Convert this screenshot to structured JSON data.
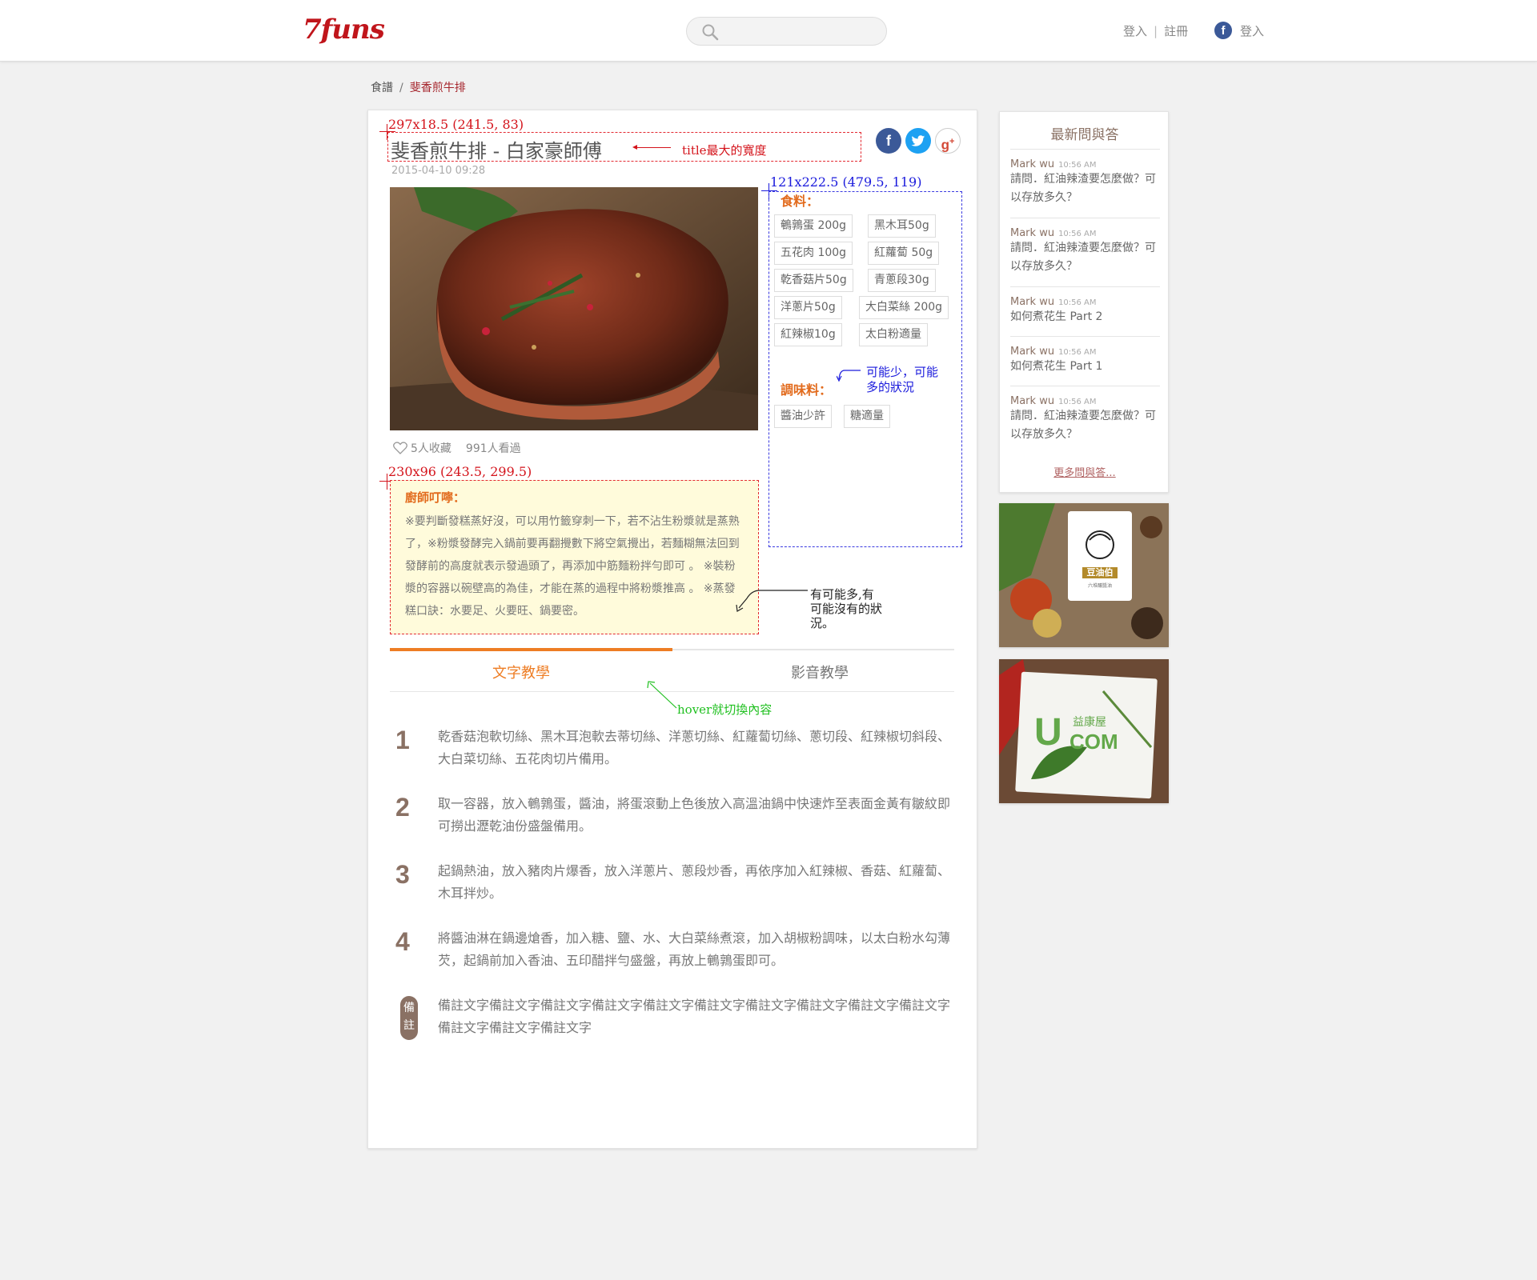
{
  "header": {
    "logo": "7funs",
    "login": "登入",
    "register": "註冊",
    "fb_login": "登入",
    "fb_icon": "f"
  },
  "breadcrumb": {
    "root": "食譜",
    "current": "斐香煎牛排"
  },
  "recipe": {
    "title": "斐香煎牛排 - 白家豪師傅",
    "date": "2015-04-10  09:28",
    "favorites": "5人收藏",
    "views": "991人看過",
    "ingredients_label": "食料：",
    "ingredients": [
      "鵪鶉蛋 200g",
      "黑木耳50g",
      "五花肉 100g",
      "紅蘿蔔 50g",
      "乾香菇片50g",
      "青蔥段30g",
      "洋蔥片50g",
      "大白菜絲 200g",
      "紅辣椒10g",
      "太白粉適量"
    ],
    "seasoning_label": "調味料：",
    "seasonings": [
      "醬油少許",
      "糖適量"
    ],
    "chef_tip_title": "廚師叮嚀：",
    "chef_tip": "※要判斷發糕蒸好沒，可以用竹籤穿刺一下，若不沾生粉漿就是蒸熟了，※粉漿發酵完入鍋前要再翻攪數下將空氣攪出，若麵糊無法回到發酵前的高度就表示發過頭了，再添加中筋麵粉拌勻即可 。 ※裝粉漿的容器以碗壁高的為佳，才能在蒸的過程中將粉漿推高 。 ※蒸發糕口訣：水要足、火要旺、鍋要密。",
    "tabs": [
      "文字教學",
      "影音教學"
    ],
    "steps": [
      {
        "num": "1",
        "text": "乾香菇泡軟切絲、黑木耳泡軟去蒂切絲、洋蔥切絲、紅蘿蔔切絲、蔥切段、紅辣椒切斜段、大白菜切絲、五花肉切片備用。"
      },
      {
        "num": "2",
        "text": "取一容器，放入鵪鶉蛋，醬油，將蛋滾動上色後放入高溫油鍋中快速炸至表面金黃有皺紋即可撈出瀝乾油份盛盤備用。"
      },
      {
        "num": "3",
        "text": "起鍋熱油，放入豬肉片爆香，放入洋蔥片、蔥段炒香，再依序加入紅辣椒、香菇、紅蘿蔔、木耳拌炒。"
      },
      {
        "num": "4",
        "text": "將醬油淋在鍋邊熗香，加入糖、鹽、水、大白菜絲煮滾，加入胡椒粉調味，以太白粉水勾薄芡，起鍋前加入香油、五印醋拌勻盛盤，再放上鵪鶉蛋即可。"
      }
    ],
    "note_badge": "備註",
    "note_text": "備註文字備註文字備註文字備註文字備註文字備註文字備註文字備註文字備註文字備註文字備註文字備註文字備註文字"
  },
  "annotations": {
    "title_dim": "297x18.5 (241.5, 83)",
    "title_note": "title最大的寬度",
    "ing_dim": "121x222.5 (479.5, 119)",
    "seasoning_note": "可能少，可能多的狀況",
    "chef_dim": "230x96 (243.5, 299.5)",
    "chef_note": "有可能多,有可能沒有的狀況。",
    "hover_note": "hover就切換內容"
  },
  "sidebar": {
    "title": "最新問與答",
    "items": [
      {
        "name": "Mark wu",
        "time": "10:56 AM",
        "q": "請問．紅油辣渣要怎麼做？可以存放多久？"
      },
      {
        "name": "Mark wu",
        "time": "10:56 AM",
        "q": "請問．紅油辣渣要怎麼做？可以存放多久？"
      },
      {
        "name": "Mark wu",
        "time": "10:56 AM",
        "q": "如何煮花生 Part 2"
      },
      {
        "name": "Mark wu",
        "time": "10:56 AM",
        "q": "如何煮花生 Part 1"
      },
      {
        "name": "Mark wu",
        "time": "10:56 AM",
        "q": "請問．紅油辣渣要怎麼做？可以存放多久？"
      }
    ],
    "more": "更多問與答...",
    "ad1_brand": "豆油伯",
    "ad1_tag": "六堆釀醬油",
    "ad2_brand_u": "U",
    "ad2_brand_com": "COM",
    "ad2_brand_cn": "益康屋"
  },
  "colors": {
    "brand": "#c0151b",
    "accent": "#ee7d24",
    "brown": "#8a7164"
  }
}
